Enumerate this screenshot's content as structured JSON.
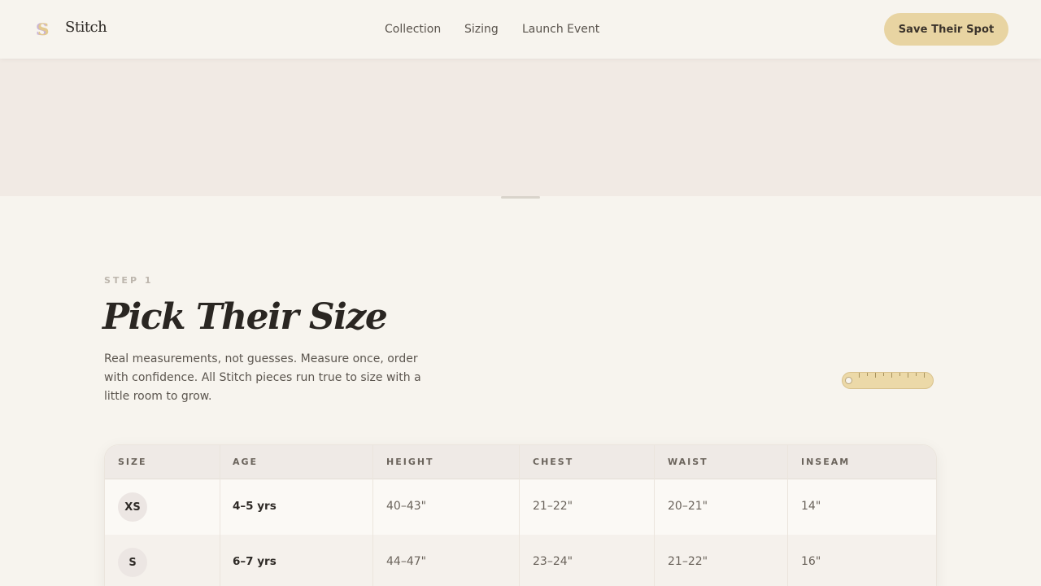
{
  "brand": {
    "logo_letter": "S",
    "name": "Stitch"
  },
  "nav": {
    "items": [
      {
        "label": "Collection"
      },
      {
        "label": "Sizing"
      },
      {
        "label": "Launch Event"
      }
    ]
  },
  "cta": {
    "label": "Save Their Spot"
  },
  "colors": {
    "background": "#f7f4ee",
    "hero": "#f1eae4",
    "accent": "#e8d4a2",
    "text": "#2e2a26"
  },
  "section": {
    "eyebrow": "STEP 1",
    "title": "Pick Their Size",
    "description": "Real measurements, not guesses. Measure once, order with confidence. All Stitch pieces run true to size with a little room to grow.",
    "decoration_icon": "measuring-tape-icon"
  },
  "size_table": {
    "headers": [
      "SIZE",
      "AGE",
      "HEIGHT",
      "CHEST",
      "WAIST",
      "INSEAM"
    ],
    "rows": [
      {
        "size": "XS",
        "age": "4–5 yrs",
        "height": "40–43\"",
        "chest": "21–22\"",
        "waist": "20–21\"",
        "inseam": "14\""
      },
      {
        "size": "S",
        "age": "6–7 yrs",
        "height": "44–47\"",
        "chest": "23–24\"",
        "waist": "21–22\"",
        "inseam": "16\""
      }
    ]
  }
}
